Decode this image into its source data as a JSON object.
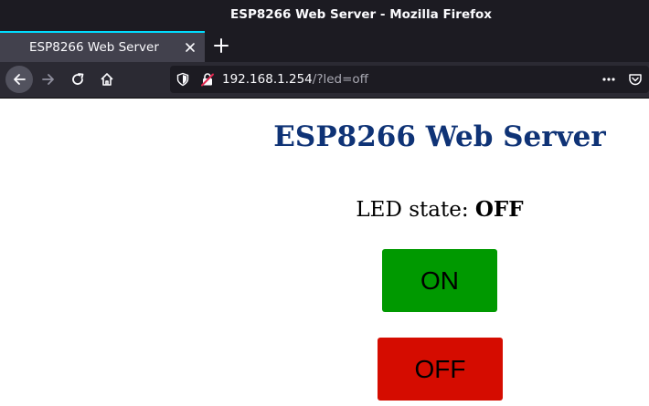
{
  "window": {
    "title": "ESP8266 Web Server - Mozilla Firefox"
  },
  "tabs": [
    {
      "label": "ESP8266 Web Server",
      "active": true
    }
  ],
  "toolbar": {
    "url_host": "192.168.1.254",
    "url_path": "/?led=off",
    "icons": [
      "back-icon",
      "forward-icon",
      "reload-icon",
      "home-icon",
      "tracking-shield-icon",
      "insecure-lock-icon",
      "page-actions-icon",
      "pocket-icon"
    ]
  },
  "page": {
    "heading": "ESP8266 Web Server",
    "state_label": "LED state: ",
    "state_value": "OFF",
    "buttons": {
      "on_label": "ON",
      "off_label": "OFF"
    }
  },
  "colors": {
    "heading": "#0f3376",
    "on_button": "#009900",
    "off_button": "#d50c00",
    "tab_accent": "#00ddff",
    "chrome_dark": "#1c1b22"
  }
}
